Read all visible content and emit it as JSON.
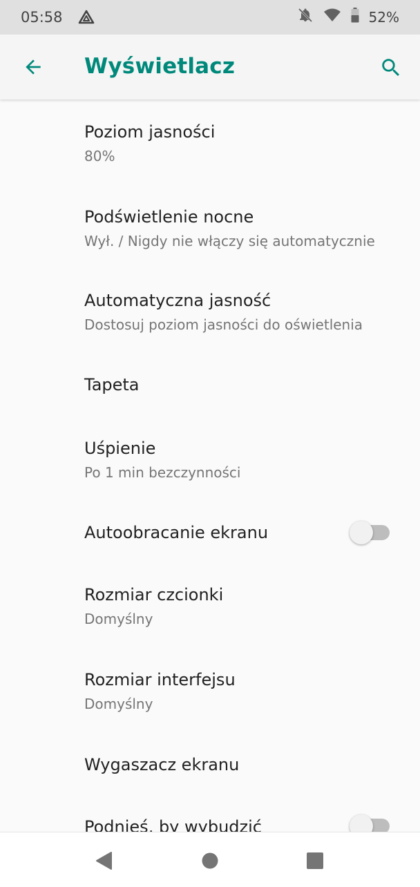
{
  "status_bar": {
    "time": "05:58",
    "battery_percent": "52%",
    "icons": [
      "drive-icon",
      "notifications-off-icon",
      "wifi-icon",
      "battery-icon"
    ]
  },
  "app_bar": {
    "title": "Wyświetlacz",
    "back_icon": "arrow-back-icon",
    "search_icon": "search-icon",
    "accent_color": "#00897b"
  },
  "settings": [
    {
      "label": "Poziom jasności",
      "summary": "80%"
    },
    {
      "label": "Podświetlenie nocne",
      "summary": "Wył. / Nigdy nie włączy się automatycznie"
    },
    {
      "label": "Automatyczna jasność",
      "summary": "Dostosuj poziom jasności do oświetlenia"
    },
    {
      "label": "Tapeta",
      "summary": ""
    },
    {
      "label": "Uśpienie",
      "summary": "Po 1 min bezczynności"
    },
    {
      "label": "Autoobracanie ekranu",
      "summary": "",
      "toggle": false
    },
    {
      "label": "Rozmiar czcionki",
      "summary": "Domyślny"
    },
    {
      "label": "Rozmiar interfejsu",
      "summary": "Domyślny"
    },
    {
      "label": "Wygaszacz ekranu",
      "summary": ""
    },
    {
      "label": "Podnieś, by wybudzić",
      "summary": "",
      "toggle": false
    }
  ],
  "nav_bar": {
    "icons": [
      "nav-back-icon",
      "home-icon",
      "recents-icon"
    ]
  }
}
